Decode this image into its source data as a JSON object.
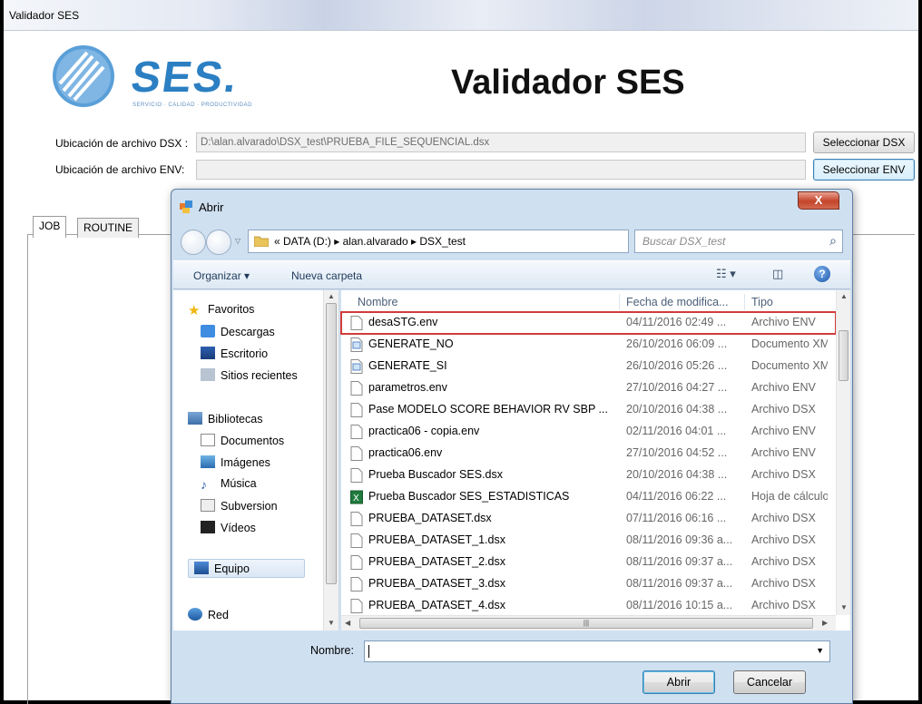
{
  "window": {
    "title": "Validador SES"
  },
  "header": {
    "logo_text": "SES.",
    "logo_tagline": "SERVICIO · CALIDAD · PRODUCTIVIDAD",
    "main_title": "Validador SES"
  },
  "dsx_row": {
    "label": "Ubicación de archivo DSX :",
    "value": "D:\\alan.alvarado\\DSX_test\\PRUEBA_FILE_SEQUENCIAL.dsx",
    "button": "Seleccionar DSX"
  },
  "env_row": {
    "label": "Ubicación de archivo ENV:",
    "value": "",
    "button": "Seleccionar ENV"
  },
  "tabs": [
    {
      "label": "JOB"
    },
    {
      "label": "ROUTINE"
    }
  ],
  "dialog": {
    "title": "Abrir",
    "close_label": "X",
    "address": "«  DATA (D:)  ▸  alan.alvarado  ▸  DSX_test",
    "search_placeholder": "Buscar DSX_test",
    "toolbar": {
      "organize": "Organizar ▾",
      "new_folder": "Nueva carpeta"
    },
    "nav": {
      "favorites": "Favoritos",
      "downloads": "Descargas",
      "desktop": "Escritorio",
      "recent": "Sitios recientes",
      "libraries": "Bibliotecas",
      "documents": "Documentos",
      "images": "Imágenes",
      "music": "Música",
      "subversion": "Subversion",
      "videos": "Vídeos",
      "computer": "Equipo",
      "network": "Red"
    },
    "columns": {
      "name": "Nombre",
      "date": "Fecha de modifica...",
      "type": "Tipo"
    },
    "files": [
      {
        "name": "desaSTG.env",
        "date": "04/11/2016 02:49 ...",
        "type": "Archivo ENV",
        "icon": "blank-file-icon"
      },
      {
        "name": "GENERATE_NO",
        "date": "26/10/2016 06:09 ...",
        "type": "Documento XML",
        "icon": "xml-file-icon"
      },
      {
        "name": "GENERATE_SI",
        "date": "26/10/2016 05:26 ...",
        "type": "Documento XML",
        "icon": "xml-file-icon"
      },
      {
        "name": "parametros.env",
        "date": "27/10/2016 04:27 ...",
        "type": "Archivo ENV",
        "icon": "blank-file-icon"
      },
      {
        "name": "Pase MODELO SCORE BEHAVIOR RV SBP ...",
        "date": "20/10/2016 04:38 ...",
        "type": "Archivo DSX",
        "icon": "blank-file-icon"
      },
      {
        "name": "practica06 - copia.env",
        "date": "02/11/2016 04:01 ...",
        "type": "Archivo ENV",
        "icon": "blank-file-icon"
      },
      {
        "name": "practica06.env",
        "date": "27/10/2016 04:52 ...",
        "type": "Archivo ENV",
        "icon": "blank-file-icon"
      },
      {
        "name": "Prueba Buscador SES.dsx",
        "date": "20/10/2016 04:38 ...",
        "type": "Archivo DSX",
        "icon": "blank-file-icon"
      },
      {
        "name": "Prueba Buscador SES_ESTADISTICAS",
        "date": "04/11/2016 06:22 ...",
        "type": "Hoja de cálculo",
        "icon": "excel-file-icon"
      },
      {
        "name": "PRUEBA_DATASET.dsx",
        "date": "07/11/2016 06:16 ...",
        "type": "Archivo DSX",
        "icon": "blank-file-icon"
      },
      {
        "name": "PRUEBA_DATASET_1.dsx",
        "date": "08/11/2016 09:36 a...",
        "type": "Archivo DSX",
        "icon": "blank-file-icon"
      },
      {
        "name": "PRUEBA_DATASET_2.dsx",
        "date": "08/11/2016 09:37 a...",
        "type": "Archivo DSX",
        "icon": "blank-file-icon"
      },
      {
        "name": "PRUEBA_DATASET_3.dsx",
        "date": "08/11/2016 09:37 a...",
        "type": "Archivo DSX",
        "icon": "blank-file-icon"
      },
      {
        "name": "PRUEBA_DATASET_4.dsx",
        "date": "08/11/2016 10:15 a...",
        "type": "Archivo DSX",
        "icon": "blank-file-icon"
      }
    ],
    "filename_label": "Nombre:",
    "filename_value": "",
    "open_button": "Abrir",
    "cancel_button": "Cancelar"
  },
  "colors": {
    "logo_blue": "#2b7fc2",
    "highlight_red": "#d33b3b",
    "dialog_frame": "#cfe0f1"
  }
}
